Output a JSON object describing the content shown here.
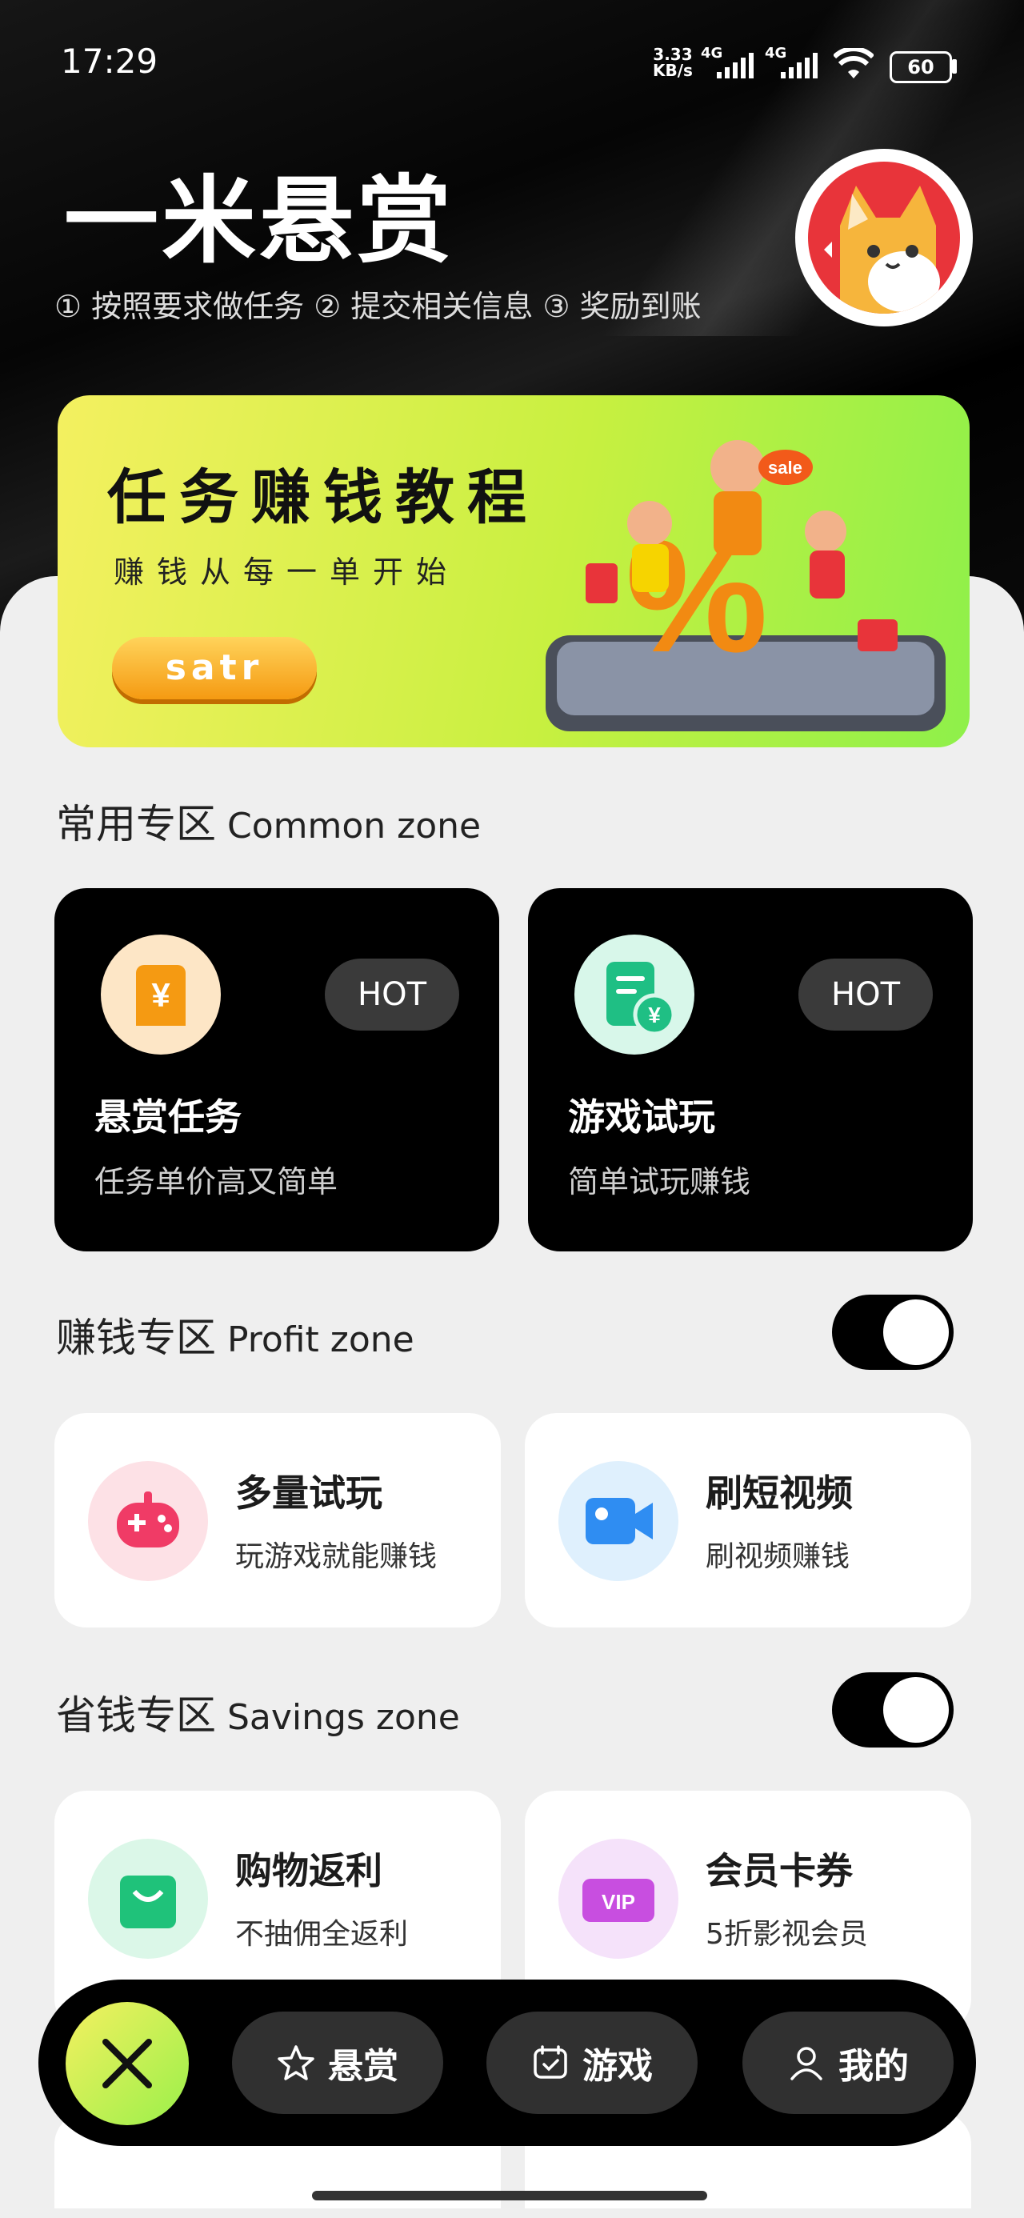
{
  "status_bar": {
    "time": "17:29",
    "net_speed_top": "3.33",
    "net_speed_bottom": "KB/s",
    "sig1": "4G",
    "sig2": "4G",
    "battery": "60"
  },
  "header": {
    "title": "一米悬赏",
    "steps": "① 按照要求做任务 ② 提交相关信息 ③ 奖励到账"
  },
  "banner": {
    "title": "任务赚钱教程",
    "subtitle": "赚钱从每一单开始",
    "button": "satr",
    "tag": "sale"
  },
  "common_zone": {
    "title": "常用专区",
    "title_en": "Common zone",
    "cards": [
      {
        "title": "悬赏任务",
        "subtitle": "任务单价高又简单",
        "badge": "HOT",
        "icon": "yen-bag-icon"
      },
      {
        "title": "游戏试玩",
        "subtitle": "简单试玩赚钱",
        "badge": "HOT",
        "icon": "receipt-yen-icon"
      }
    ]
  },
  "profit_zone": {
    "title": "赚钱专区",
    "title_en": "Profit zone",
    "cards": [
      {
        "title": "多量试玩",
        "subtitle": "玩游戏就能赚钱",
        "icon": "gamepad-icon"
      },
      {
        "title": "刷短视频",
        "subtitle": "刷视频赚钱",
        "icon": "video-camera-icon"
      }
    ]
  },
  "savings_zone": {
    "title": "省钱专区",
    "title_en": "Savings zone",
    "cards": [
      {
        "title": "购物返利",
        "subtitle": "不抽佣全返利",
        "icon": "shopping-bag-icon"
      },
      {
        "title": "会员卡券",
        "subtitle": "5折影视会员",
        "icon": "vip-ticket-icon",
        "icon_text": "VIP"
      }
    ]
  },
  "nav": {
    "items": [
      {
        "label": "悬赏",
        "icon": "star-icon"
      },
      {
        "label": "游戏",
        "icon": "calendar-check-icon"
      },
      {
        "label": "我的",
        "icon": "user-icon"
      }
    ]
  }
}
